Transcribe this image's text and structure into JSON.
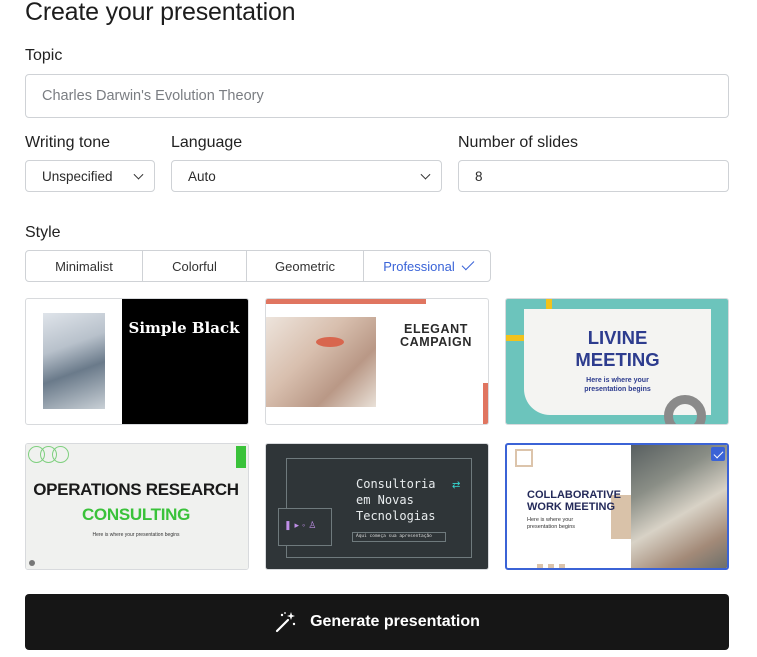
{
  "title": "Create your presentation",
  "topic": {
    "label": "Topic",
    "placeholder": "Charles Darwin's Evolution Theory"
  },
  "writing_tone": {
    "label": "Writing tone",
    "value": "Unspecified"
  },
  "language": {
    "label": "Language",
    "value": "Auto"
  },
  "slides": {
    "label": "Number of slides",
    "value": "8"
  },
  "style": {
    "label": "Style",
    "options": [
      "Minimalist",
      "Colorful",
      "Geometric",
      "Professional"
    ],
    "selected": "Professional"
  },
  "templates": [
    {
      "title": "Simple Black"
    },
    {
      "title_line1": "ELEGANT",
      "title_line2": "CAMPAIGN"
    },
    {
      "title_line1": "LIVINE",
      "title_line2": "MEETING",
      "sub_line1": "Here is where your",
      "sub_line2": "presentation begins"
    },
    {
      "title_line1": "OPERATIONS RESEARCH",
      "title_line2": "CONSULTING",
      "sub": "Here is where your presentation begins"
    },
    {
      "title_line1": "Consultoria",
      "title_line2": "em Novas",
      "title_line3": "Tecnologias",
      "sub": "Aqui começa sua apresentação"
    },
    {
      "title_line1": "COLLABORATIVE",
      "title_line2": "WORK MEETING",
      "sub_line1": "Here is where your",
      "sub_line2": "presentation begins",
      "selected": true
    }
  ],
  "generate_button": {
    "label": "Generate presentation",
    "icon": "magic-wand-icon"
  },
  "colors": {
    "accent": "#3b63d6",
    "button_bg": "#161616"
  }
}
